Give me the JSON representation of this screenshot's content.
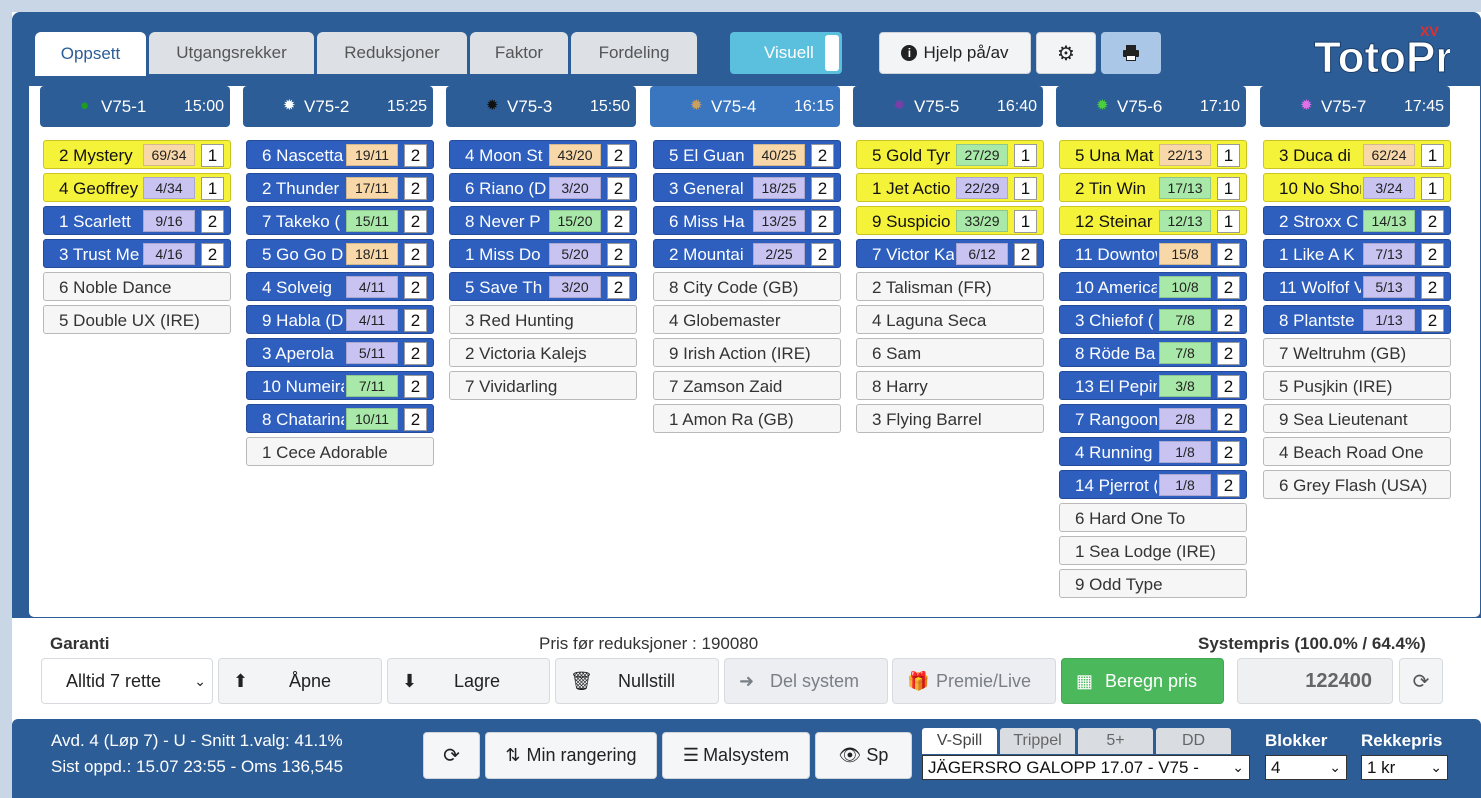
{
  "tabs": [
    {
      "label": "Oppsett",
      "active": true
    },
    {
      "label": "Utgangsrekker"
    },
    {
      "label": "Reduksjoner"
    },
    {
      "label": "Faktor"
    },
    {
      "label": "Fordeling"
    }
  ],
  "header": {
    "visuell_label": "Visuell",
    "help_label": "Hjelp på/av",
    "help_icon": "info-circle-icon",
    "settings_icon": "gear-icon",
    "print_icon": "print-icon",
    "logo_text": "TotoPro",
    "logo_badge": "XV"
  },
  "races": [
    {
      "name": "V75-1",
      "time": "15:00",
      "dot_color": "#1e9e1e",
      "horses": [
        {
          "name": "2 Mystery",
          "odds": "69/34",
          "rank": "1",
          "style": "yellow",
          "odds_color": "#f8d8a8"
        },
        {
          "name": "4 Geoffrey",
          "odds": "4/34",
          "rank": "1",
          "style": "yellow",
          "odds_color": "#c9c3f2"
        },
        {
          "name": "1 Scarlett",
          "odds": "9/16",
          "rank": "2",
          "style": "blue",
          "odds_color": "#c9c3f2"
        },
        {
          "name": "3 Trust Me",
          "odds": "4/16",
          "rank": "2",
          "style": "blue",
          "odds_color": "#c9c3f2"
        },
        {
          "name": "6 Noble Dance",
          "style": "plain"
        },
        {
          "name": "5 Double UX (IRE)",
          "style": "plain"
        }
      ]
    },
    {
      "name": "V75-2",
      "time": "15:25",
      "dot_color": "#ffffff",
      "horses": [
        {
          "name": "6 Nascetta",
          "odds": "19/11",
          "rank": "2",
          "style": "blue",
          "odds_color": "#f8d8a8"
        },
        {
          "name": "2 Thunder",
          "odds": "17/11",
          "rank": "2",
          "style": "blue",
          "odds_color": "#f8d8a8"
        },
        {
          "name": "7 Takeko (",
          "odds": "15/11",
          "rank": "2",
          "style": "blue",
          "odds_color": "#a8e8a8"
        },
        {
          "name": "5 Go Go D",
          "odds": "18/11",
          "rank": "2",
          "style": "blue",
          "odds_color": "#f8d8a8"
        },
        {
          "name": "4 Solveig",
          "odds": "4/11",
          "rank": "2",
          "style": "blue",
          "odds_color": "#c9c3f2"
        },
        {
          "name": "9 Habla (D",
          "odds": "4/11",
          "rank": "2",
          "style": "blue",
          "odds_color": "#c9c3f2"
        },
        {
          "name": "3 Aperola",
          "odds": "5/11",
          "rank": "2",
          "style": "blue",
          "odds_color": "#c9c3f2"
        },
        {
          "name": "10 Numeira",
          "odds": "7/11",
          "rank": "2",
          "style": "blue",
          "odds_color": "#a8e8a8"
        },
        {
          "name": "8 Chatarina",
          "odds": "10/11",
          "rank": "2",
          "style": "blue",
          "odds_color": "#a8e8a8"
        },
        {
          "name": "1 Cece Adorable",
          "style": "plain"
        }
      ]
    },
    {
      "name": "V75-3",
      "time": "15:50",
      "dot_color": "#111111",
      "horses": [
        {
          "name": "4 Moon St",
          "odds": "43/20",
          "rank": "2",
          "style": "blue",
          "odds_color": "#f8d8a8"
        },
        {
          "name": "6 Riano (D",
          "odds": "3/20",
          "rank": "2",
          "style": "blue",
          "odds_color": "#c9c3f2"
        },
        {
          "name": "8 Never P",
          "odds": "15/20",
          "rank": "2",
          "style": "blue",
          "odds_color": "#a8e8a8"
        },
        {
          "name": "1 Miss Do",
          "odds": "5/20",
          "rank": "2",
          "style": "blue",
          "odds_color": "#c9c3f2"
        },
        {
          "name": "5 Save Th",
          "odds": "3/20",
          "rank": "2",
          "style": "blue",
          "odds_color": "#c9c3f2"
        },
        {
          "name": "3 Red Hunting",
          "style": "plain"
        },
        {
          "name": "2 Victoria Kalejs",
          "style": "plain"
        },
        {
          "name": "7 Vividarling",
          "style": "plain"
        }
      ]
    },
    {
      "name": "V75-4",
      "time": "16:15",
      "dot_color": "#c8a060",
      "active": true,
      "horses": [
        {
          "name": "5 El Guan",
          "odds": "40/25",
          "rank": "2",
          "style": "blue",
          "odds_color": "#f8d8a8"
        },
        {
          "name": "3 General",
          "odds": "18/25",
          "rank": "2",
          "style": "blue",
          "odds_color": "#c9c3f2"
        },
        {
          "name": "6 Miss Ha",
          "odds": "13/25",
          "rank": "2",
          "style": "blue",
          "odds_color": "#c9c3f2"
        },
        {
          "name": "2 Mountai",
          "odds": "2/25",
          "rank": "2",
          "style": "blue",
          "odds_color": "#c9c3f2"
        },
        {
          "name": "8 City Code (GB)",
          "style": "plain"
        },
        {
          "name": "4 Globemaster",
          "style": "plain"
        },
        {
          "name": "9 Irish Action (IRE)",
          "style": "plain"
        },
        {
          "name": "7 Zamson Zaid",
          "style": "plain"
        },
        {
          "name": "1 Amon Ra (GB)",
          "style": "plain"
        }
      ]
    },
    {
      "name": "V75-5",
      "time": "16:40",
      "dot_color": "#7a3ea8",
      "horses": [
        {
          "name": "5 Gold Tyr",
          "odds": "27/29",
          "rank": "1",
          "style": "yellow",
          "odds_color": "#a8e8a8"
        },
        {
          "name": "1 Jet Actio",
          "odds": "22/29",
          "rank": "1",
          "style": "yellow",
          "odds_color": "#c9c3f2"
        },
        {
          "name": "9 Suspicio",
          "odds": "33/29",
          "rank": "1",
          "style": "yellow",
          "odds_color": "#a8e8a8"
        },
        {
          "name": "7 Victor Ka",
          "odds": "6/12",
          "rank": "2",
          "style": "blue",
          "odds_color": "#c9c3f2"
        },
        {
          "name": "2 Talisman (FR)",
          "style": "plain"
        },
        {
          "name": "4 Laguna Seca",
          "style": "plain"
        },
        {
          "name": "6 Sam",
          "style": "plain"
        },
        {
          "name": "8 Harry",
          "style": "plain"
        },
        {
          "name": "3 Flying Barrel",
          "style": "plain"
        }
      ]
    },
    {
      "name": "V75-6",
      "time": "17:10",
      "dot_color": "#4ccf3c",
      "horses": [
        {
          "name": "5 Una Mat",
          "odds": "22/13",
          "rank": "1",
          "style": "yellow",
          "odds_color": "#f8d8a8"
        },
        {
          "name": "2 Tin Win",
          "odds": "17/13",
          "rank": "1",
          "style": "yellow",
          "odds_color": "#a8e8a8"
        },
        {
          "name": "12 Steinar (",
          "odds": "12/13",
          "rank": "1",
          "style": "yellow",
          "odds_color": "#a8e8a8"
        },
        {
          "name": "11 Downtow",
          "odds": "15/8",
          "rank": "2",
          "style": "blue",
          "odds_color": "#f8d8a8"
        },
        {
          "name": "10 America",
          "odds": "10/8",
          "rank": "2",
          "style": "blue",
          "odds_color": "#a8e8a8"
        },
        {
          "name": "3 Chiefof (",
          "odds": "7/8",
          "rank": "2",
          "style": "blue",
          "odds_color": "#a8e8a8"
        },
        {
          "name": "8 Röde Ba",
          "odds": "7/8",
          "rank": "2",
          "style": "blue",
          "odds_color": "#a8e8a8"
        },
        {
          "name": "13 El Pepin",
          "odds": "3/8",
          "rank": "2",
          "style": "blue",
          "odds_color": "#a8e8a8"
        },
        {
          "name": "7 Rangoon",
          "odds": "2/8",
          "rank": "2",
          "style": "blue",
          "odds_color": "#c9c3f2"
        },
        {
          "name": "4 Running",
          "odds": "1/8",
          "rank": "2",
          "style": "blue",
          "odds_color": "#c9c3f2"
        },
        {
          "name": "14 Pjerrot (",
          "odds": "1/8",
          "rank": "2",
          "style": "blue",
          "odds_color": "#c9c3f2"
        },
        {
          "name": "6 Hard One To",
          "style": "plain"
        },
        {
          "name": "1 Sea Lodge (IRE)",
          "style": "plain"
        },
        {
          "name": "9 Odd Type",
          "style": "plain"
        }
      ]
    },
    {
      "name": "V75-7",
      "time": "17:45",
      "dot_color": "#e070e8",
      "horses": [
        {
          "name": "3 Duca di",
          "odds": "62/24",
          "rank": "1",
          "style": "yellow",
          "odds_color": "#f8d8a8"
        },
        {
          "name": "10 No Shor",
          "odds": "3/24",
          "rank": "1",
          "style": "yellow",
          "odds_color": "#c9c3f2"
        },
        {
          "name": "2 Stroxx C",
          "odds": "14/13",
          "rank": "2",
          "style": "blue",
          "odds_color": "#a8e8a8"
        },
        {
          "name": "1 Like A K",
          "odds": "7/13",
          "rank": "2",
          "style": "blue",
          "odds_color": "#c9c3f2"
        },
        {
          "name": "11 Wolfof V",
          "odds": "5/13",
          "rank": "2",
          "style": "blue",
          "odds_color": "#c9c3f2"
        },
        {
          "name": "8 Plantste",
          "odds": "1/13",
          "rank": "2",
          "style": "blue",
          "odds_color": "#c9c3f2"
        },
        {
          "name": "7 Weltruhm (GB)",
          "style": "plain"
        },
        {
          "name": "5 Pusjkin (IRE)",
          "style": "plain"
        },
        {
          "name": "9 Sea Lieutenant",
          "style": "plain"
        },
        {
          "name": "4 Beach Road One",
          "style": "plain"
        },
        {
          "name": "6 Grey Flash (USA)",
          "style": "plain"
        }
      ]
    }
  ],
  "controls": {
    "garanti_label": "Garanti",
    "pris_label": "Pris før reduksjoner : 190080",
    "systempris_label": "Systempris (100.0% / 64.4%)",
    "garanti_value": "Alltid 7 rette",
    "open_label": "Åpne",
    "save_label": "Lagre",
    "reset_label": "Nullstill",
    "share_label": "Del system",
    "prize_label": "Premie/Live",
    "calc_label": "Beregn pris",
    "price_value": "122400"
  },
  "status": {
    "line1": "Avd. 4 (Løp 7) - U - Snitt 1.valg: 41.1%",
    "line2": "Sist oppd.: 15.07 23:55 - Oms 136,545",
    "min_rangering": "Min rangering",
    "malsystem": "Malsystem",
    "sp": "Sp",
    "game_tabs": [
      "V-Spill",
      "Trippel",
      "5+",
      "DD"
    ],
    "race_select": "JÄGERSRO GALOPP 17.07 - V75 -",
    "blokker_label": "Blokker",
    "blokker_value": "4",
    "rekkepris_label": "Rekkepris",
    "rekkepris_value": "1 kr"
  }
}
